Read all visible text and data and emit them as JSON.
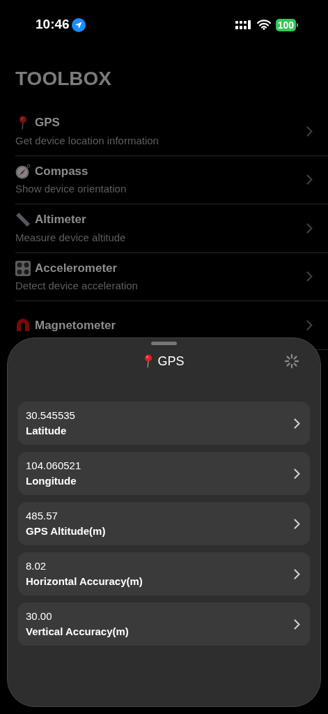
{
  "status_bar": {
    "time": "10:46",
    "battery": "100"
  },
  "title": "TOOLBOX",
  "tools": [
    {
      "title": "GPS",
      "subtitle": "Get device location information"
    },
    {
      "title": "Compass",
      "subtitle": "Show device orientation"
    },
    {
      "title": "Altimeter",
      "subtitle": "Measure device altitude"
    },
    {
      "title": "Accelerometer",
      "subtitle": "Detect device acceleration"
    },
    {
      "title": "Magnetometer"
    }
  ],
  "sheet": {
    "title": "GPS",
    "rows": [
      {
        "value": "30.545535",
        "label": "Latitude"
      },
      {
        "value": "104.060521",
        "label": "Longitude"
      },
      {
        "value": "485.57",
        "label": "GPS Altitude(m)"
      },
      {
        "value": "8.02",
        "label": "Horizontal Accuracy(m)"
      },
      {
        "value": "30.00",
        "label": "Vertical Accuracy(m)"
      }
    ]
  }
}
